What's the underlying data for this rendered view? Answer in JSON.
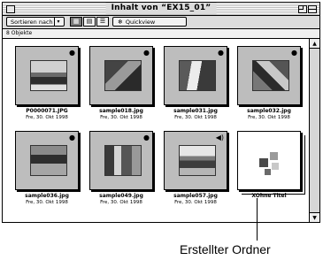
{
  "window": {
    "title": "Inhalt von “EX15_01”"
  },
  "toolbar": {
    "sort_label": "Sortieren nach",
    "sort_arrow": "▾",
    "view_icons": [
      "▦",
      "▤",
      "☰"
    ],
    "quickview_label": "Quickview",
    "quickview_icon": "❄"
  },
  "status": {
    "text": "8 Objekte"
  },
  "files": [
    {
      "name": "P0000071.JPG",
      "date": "Fre, 30. Okt 1998",
      "mark": "●",
      "photo": "p1"
    },
    {
      "name": "sample018.jpg",
      "date": "Fre, 30. Okt 1998",
      "mark": "●",
      "photo": "p2"
    },
    {
      "name": "sample031.jpg",
      "date": "Fre, 30. Okt 1998",
      "mark": "●",
      "photo": "p3"
    },
    {
      "name": "sample032.jpg",
      "date": "Fre, 30. Okt 1998",
      "mark": "●",
      "photo": "p4"
    },
    {
      "name": "sample036.jpg",
      "date": "Fre, 30. Okt 1998",
      "mark": "●",
      "photo": "p5"
    },
    {
      "name": "sample049.jpg",
      "date": "Fre, 30. Okt 1998",
      "mark": "●",
      "photo": "p6"
    },
    {
      "name": "sample057.jpg",
      "date": "Fre, 30. Okt 1998",
      "mark": "◀)",
      "photo": "p7"
    },
    {
      "name": "XOhne Titel",
      "date": "",
      "mark": "",
      "photo": ""
    }
  ],
  "annotation": {
    "label": "Erstellter Ordner"
  },
  "scrollbar": {
    "up_arrow": "▲",
    "down_arrow": "▼"
  }
}
